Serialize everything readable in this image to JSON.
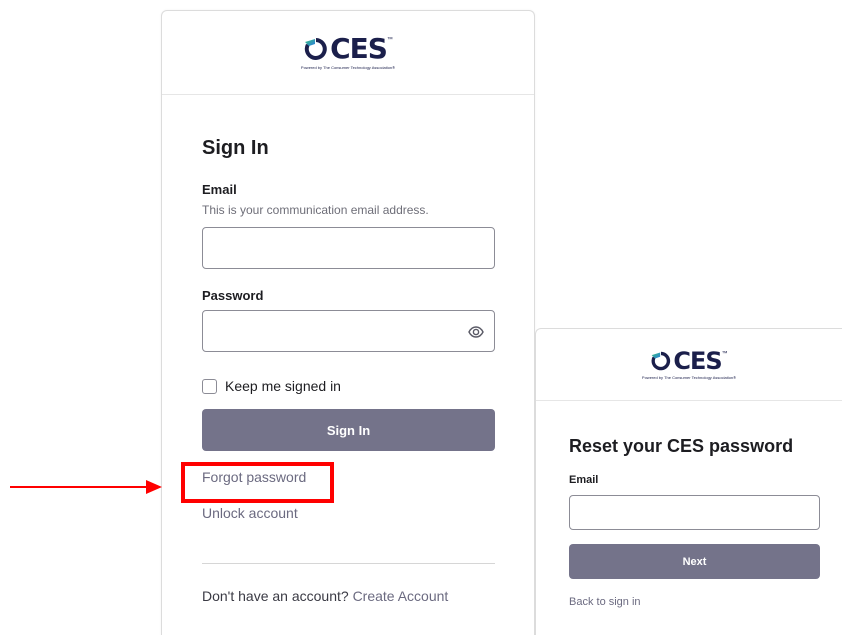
{
  "signin": {
    "logo": {
      "text": "CES",
      "tm": "™",
      "tagline": "Powered by The Consumer Technology Association®"
    },
    "title": "Sign In",
    "email_label": "Email",
    "email_hint": "This is your communication email address.",
    "email_value": "",
    "password_label": "Password",
    "password_value": "",
    "remember_label": "Keep me signed in",
    "remember_checked": false,
    "signin_button": "Sign In",
    "forgot_link": "Forgot password",
    "unlock_link": "Unlock account",
    "signup_prompt": "Don't have an account?",
    "signup_link": "Create Account"
  },
  "reset": {
    "logo": {
      "text": "CES",
      "tm": "™",
      "tagline": "Powered by The Consumer Technology Association®"
    },
    "title": "Reset your CES password",
    "email_label": "Email",
    "email_value": "",
    "next_button": "Next",
    "back_link": "Back to sign in"
  },
  "annotation": {
    "highlight_color": "#ff0000",
    "arrow_color": "#ff0000"
  },
  "colors": {
    "button_bg": "#74738a",
    "logo_navy": "#1b1f4b",
    "logo_accent_green": "#3ac17c",
    "logo_accent_blue": "#2a7de1"
  }
}
